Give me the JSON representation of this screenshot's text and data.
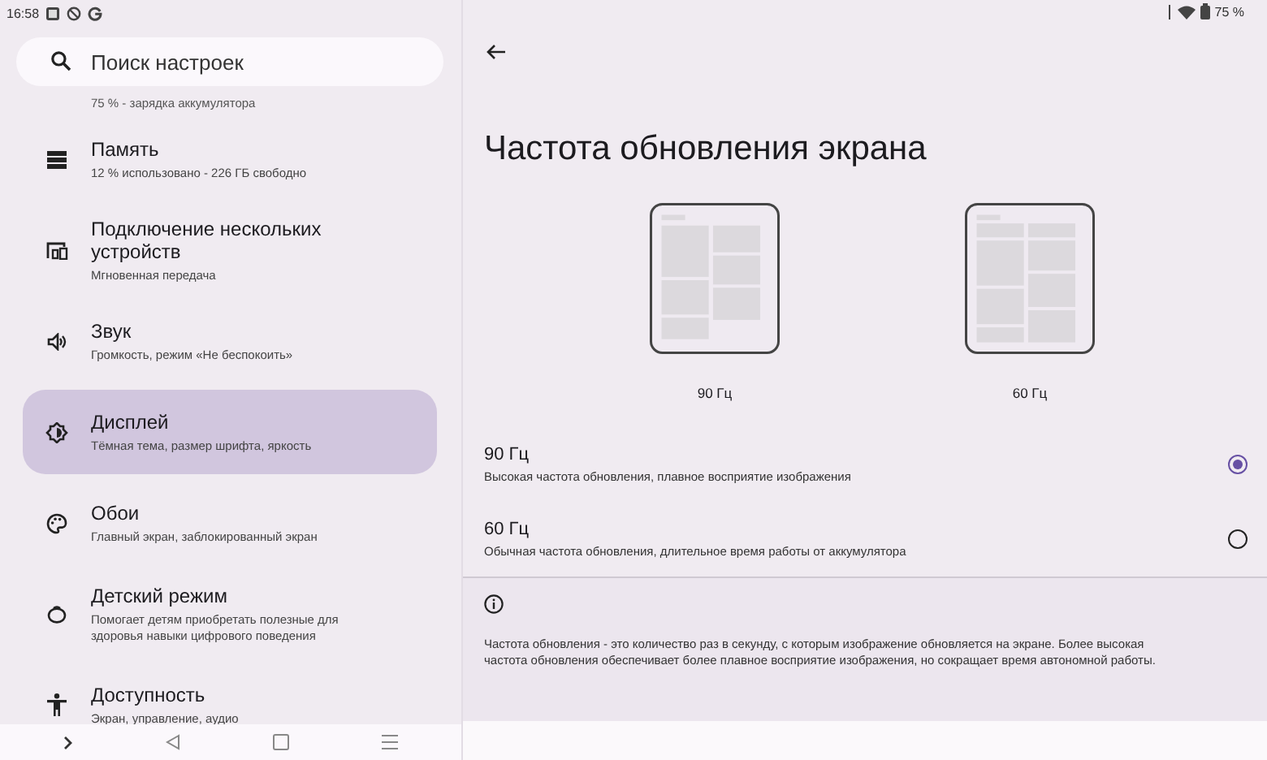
{
  "status_bar": {
    "time": "16:58",
    "battery": "75 %"
  },
  "search": {
    "placeholder": "Поиск настроек"
  },
  "sidebar": {
    "cut_subtitle": "75 % - зарядка аккумулятора",
    "items": [
      {
        "kind": "storage",
        "title": "Память",
        "subtitle": "12 % использовано - 226 ГБ свободно",
        "selected": false
      },
      {
        "kind": "devices",
        "title": "Подключение нескольких устройств",
        "subtitle": "Мгновенная передача",
        "selected": false
      },
      {
        "kind": "sound",
        "title": "Звук",
        "subtitle": "Громкость, режим «Не беспокоить»",
        "selected": false
      },
      {
        "kind": "display",
        "title": "Дисплей",
        "subtitle": "Тёмная тема, размер шрифта, яркость",
        "selected": true
      },
      {
        "kind": "palette",
        "title": "Обои",
        "subtitle": "Главный экран, заблокированный экран",
        "selected": false
      },
      {
        "kind": "kids",
        "title": "Детский режим",
        "subtitle": "Помогает детям приобретать полезные для здоровья навыки цифрового поведения",
        "selected": false
      },
      {
        "kind": "accessibility",
        "title": "Доступность",
        "subtitle": "Экран, управление, аудио",
        "selected": false
      }
    ]
  },
  "page": {
    "title": "Частота обновления экрана",
    "previews": [
      {
        "kind": "large",
        "label": "90 Гц"
      },
      {
        "kind": "small",
        "label": "60 Гц"
      }
    ],
    "options": [
      {
        "title": "90 Гц",
        "subtitle": "Высокая частота обновления, плавное восприятие изображения",
        "selected": true
      },
      {
        "title": "60 Гц",
        "subtitle": "Обычная частота обновления, длительное время работы от аккумулятора",
        "selected": false
      }
    ],
    "info": "Частота обновления - это количество раз в секунду, с которым изображение обновляется на экране. Более высокая частота обновления обеспечивает более плавное восприятие изображения, но сокращает время автономной работы."
  }
}
